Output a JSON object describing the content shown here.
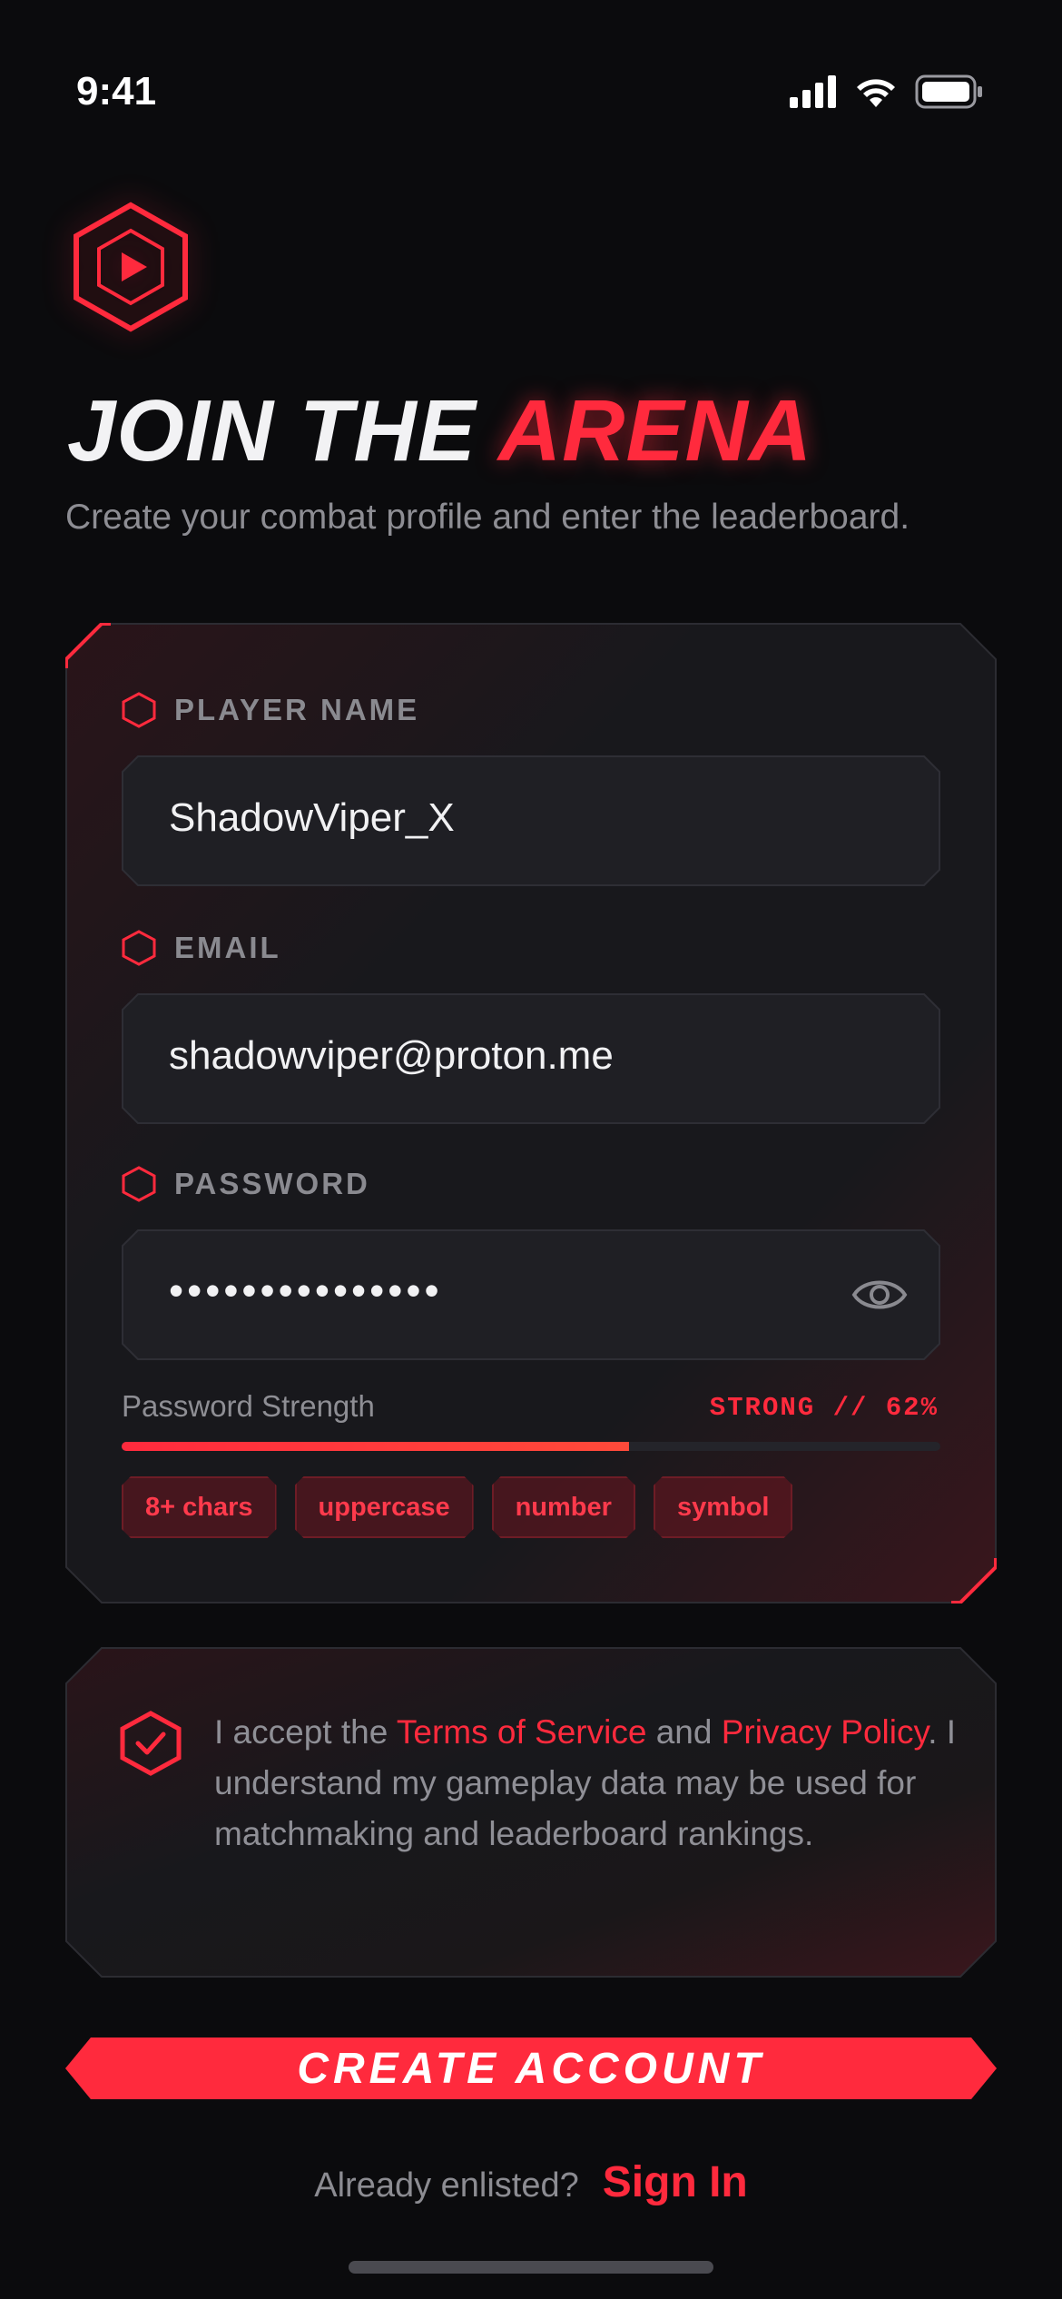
{
  "status_bar": {
    "time": "9:41",
    "icons": [
      "signal-icon",
      "wifi-icon",
      "battery-icon"
    ]
  },
  "header": {
    "logo_icon": "hexagon-play-icon",
    "title_part1": "JOIN THE",
    "title_part2": "ARENA",
    "subtitle": "Create your combat profile and enter the leaderboard."
  },
  "form": {
    "player_name": {
      "label": "PLAYER NAME",
      "value": "ShadowViper_X"
    },
    "email": {
      "label": "EMAIL",
      "value": "shadowviper@proton.me"
    },
    "password": {
      "label": "PASSWORD",
      "value": "•••••••••••••••",
      "toggle_icon": "eye-icon"
    },
    "strength": {
      "label": "Password Strength",
      "status": "STRONG // 62%",
      "fraction": 0.62,
      "requirements": [
        "8+ chars",
        "uppercase",
        "number",
        "symbol"
      ]
    }
  },
  "terms": {
    "checked": true,
    "text_before": "I accept the ",
    "link_terms": "Terms of Service",
    "text_and": " and ",
    "link_privacy": "Privacy Policy",
    "text_after": ". I understand my gameplay data may be used for matchmaking and leaderboard rankings."
  },
  "cta": {
    "label": "CREATE ACCOUNT"
  },
  "signin": {
    "prompt": "Already enlisted?",
    "link": "Sign In"
  },
  "colors": {
    "accent": "#ff2a3d",
    "background": "#0b0b0d",
    "panel": "#18181c",
    "muted_text": "#8d8d93"
  }
}
